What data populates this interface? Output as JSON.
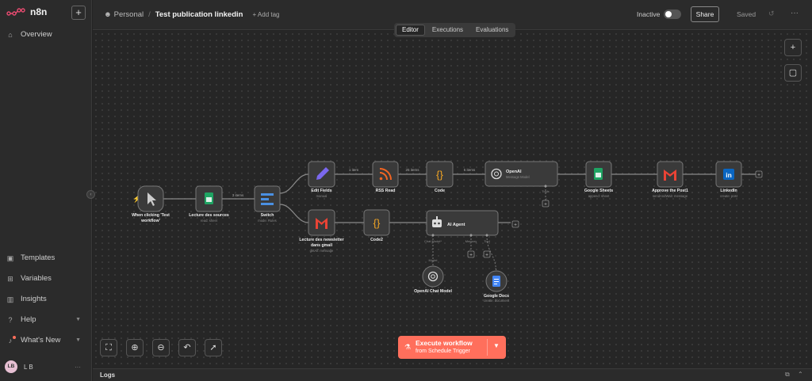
{
  "app": {
    "name": "n8n",
    "new_label": "+"
  },
  "sidebar": {
    "overview": "Overview",
    "bottom_items": [
      {
        "label": "Templates",
        "icon": "templates-icon"
      },
      {
        "label": "Variables",
        "icon": "variables-icon"
      },
      {
        "label": "Insights",
        "icon": "insights-icon"
      },
      {
        "label": "Help",
        "icon": "help-icon"
      },
      {
        "label": "What's New",
        "icon": "bell-icon"
      }
    ],
    "user_initials": "LB",
    "user_name": "L B"
  },
  "header": {
    "owner": "Personal",
    "separator": "/",
    "workflow_name": "Test publication linkedin",
    "add_tag": "+ Add tag",
    "status": "Inactive",
    "share": "Share",
    "saved": "Saved"
  },
  "tabs": [
    "Editor",
    "Executions",
    "Evaluations"
  ],
  "nodes": {
    "trigger": {
      "title": "When clicking 'Test",
      "title2": "workflow'"
    },
    "sheets_read": {
      "title": "Lecture des sources",
      "sub": "read: sheet"
    },
    "switch": {
      "title": "Switch",
      "sub": "mode: Rules"
    },
    "edit": {
      "title": "Edit Fields",
      "sub": "manual"
    },
    "rss": {
      "title": "RSS Read"
    },
    "code": {
      "title": "Code"
    },
    "openai": {
      "title": "OpenAI",
      "sub": "Message Model",
      "port": "Tools"
    },
    "gsheets": {
      "title": "Google Sheets",
      "sub": "append: sheet"
    },
    "approve": {
      "title": "Approve the Post1",
      "sub": "sendAndWait: message"
    },
    "linkedin": {
      "title": "LinkedIn",
      "sub": "create: post"
    },
    "gmail": {
      "title": "Lecture des newsletter",
      "title2": "dans gmail",
      "sub": "getAll: message"
    },
    "code2": {
      "title": "Code2"
    },
    "agent": {
      "title": "AI Agent",
      "ports": [
        "Chat Model*",
        "Memory",
        "Tool"
      ]
    },
    "chatmodel": {
      "title": "OpenAI Chat Model",
      "port": "Model"
    },
    "gdocs": {
      "title": "Google Docs",
      "sub": "create: document"
    }
  },
  "edges": {
    "e1": "3 items",
    "e2": "1 item",
    "e3": "25 items",
    "e4": "5 items"
  },
  "execute": {
    "title": "Execute workflow",
    "subtitle": "from Schedule Trigger"
  },
  "logs": {
    "label": "Logs"
  },
  "colors": {
    "accent": "#ff6f5c",
    "sheets": "#1fa463",
    "rss": "#f26522",
    "code": "#f5a623",
    "linkedin": "#0a66c2",
    "edit": "#7b68ee"
  }
}
